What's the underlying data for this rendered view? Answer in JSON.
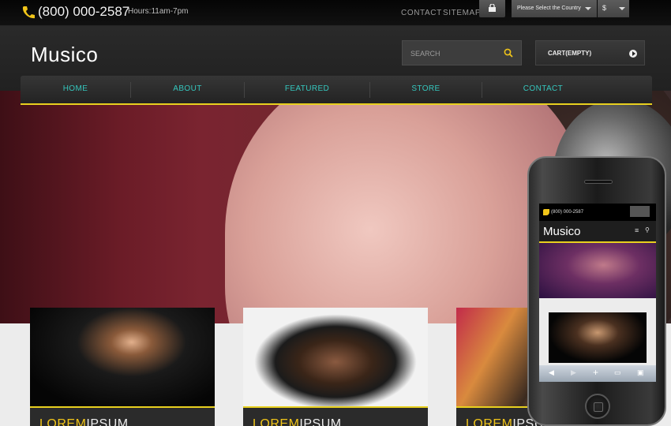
{
  "topbar": {
    "phone": "(800) 000-2587",
    "hours": "Hours:11am-7pm",
    "links": [
      "CONTACT",
      "SITEMAP"
    ],
    "country_placeholder": "Please Select the Country",
    "currency": "$",
    "icons": {
      "phone": "phone-icon",
      "lock": "lock-icon"
    }
  },
  "header": {
    "logo": "Musico",
    "search_placeholder": "SEARCH",
    "cart_label": "CART(EMPTY)"
  },
  "nav": {
    "items": [
      "HOME",
      "ABOUT",
      "FEATURED",
      "STORE",
      "CONTACT"
    ]
  },
  "cards": [
    {
      "highlight": "LOREM",
      "rest": "IPSUM"
    },
    {
      "highlight": "LOREM",
      "rest": "IPSUM"
    },
    {
      "highlight": "LOREM",
      "rest": "IPSUM"
    }
  ],
  "mobile": {
    "phone": "(800) 000-2587",
    "logo": "Musico"
  },
  "colors": {
    "accent_yellow": "#e8d01f",
    "nav_text": "#35c6bd",
    "background": "#1b1b1b"
  }
}
